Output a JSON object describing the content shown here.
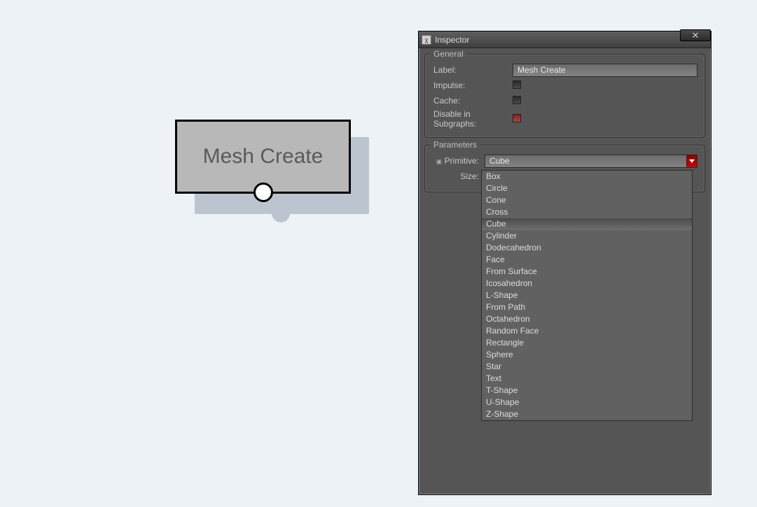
{
  "node": {
    "label": "Mesh Create"
  },
  "inspector": {
    "title": "Inspector",
    "close_glyph": "✕",
    "groups": {
      "general": {
        "title": "General",
        "label_field_label": "Label:",
        "label_value": "Mesh Create",
        "impulse_label": "Impulse:",
        "cache_label": "Cache:",
        "disable_subgraphs_label": "Disable in Subgraphs:"
      },
      "parameters": {
        "title": "Parameters",
        "primitive_label": "Primitive:",
        "primitive_value": "Cube",
        "size_label": "Size:",
        "options": [
          "Box",
          "Circle",
          "Cone",
          "Cross",
          "Cube",
          "Cylinder",
          "Dodecahedron",
          "Face",
          "From Surface",
          "Icosahedron",
          "L-Shape",
          "From Path",
          "Octahedron",
          "Random Face",
          "Rectangle",
          "Sphere",
          "Star",
          "Text",
          "T-Shape",
          "U-Shape",
          "Z-Shape"
        ],
        "selected_option": "Cube"
      }
    }
  }
}
